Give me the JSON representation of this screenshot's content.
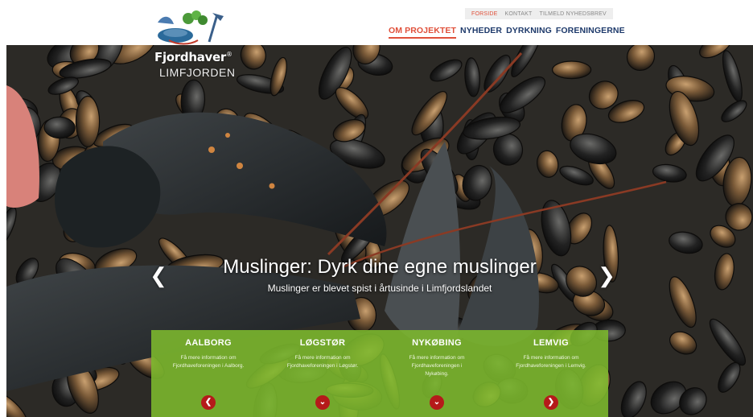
{
  "logo": {
    "brand": "Fjordhaver",
    "brand_mark": "®",
    "sub": "LIMFJORDEN"
  },
  "topbar": {
    "items": [
      {
        "label": "FORSIDE",
        "active": true
      },
      {
        "label": "KONTAKT"
      },
      {
        "label": "TILMELD NYHEDSBREV"
      }
    ]
  },
  "mainnav": {
    "items": [
      {
        "label": "OM PROJEKTET",
        "active": true
      },
      {
        "label": "NYHEDER"
      },
      {
        "label": "DYRKNING"
      },
      {
        "label": "FORENINGERNE"
      }
    ]
  },
  "slider": {
    "title": "Muslinger: Dyrk dine egne muslinger",
    "subtitle": "Muslinger er blevet spist i årtusinde i Limfjordslandet",
    "prev_icon": "chevron-left-icon",
    "next_icon": "chevron-right-icon"
  },
  "panels": [
    {
      "title": "AALBORG",
      "text": "Få mere information om Fjordhaveforeningen i Aalborg.",
      "button_icon": "chevron-left-icon"
    },
    {
      "title": "LØGSTØR",
      "text": "Få mere information om Fjordhaveforeningen i Løgstør.",
      "button_icon": "chevron-down-icon"
    },
    {
      "title": "NYKØBING",
      "text": "Få mere information om Fjordhaveforeningen i Nykøbing.",
      "button_icon": "chevron-down-icon"
    },
    {
      "title": "LEMVIG",
      "text": "Få mere information om Fjordhaveforeningen i Lemvig.",
      "button_icon": "chevron-right-icon"
    }
  ],
  "colors": {
    "accent": "#e0503a",
    "nav": "#1e3a6b",
    "panel_green": "#7db92d",
    "button_red": "#b51a1a"
  }
}
